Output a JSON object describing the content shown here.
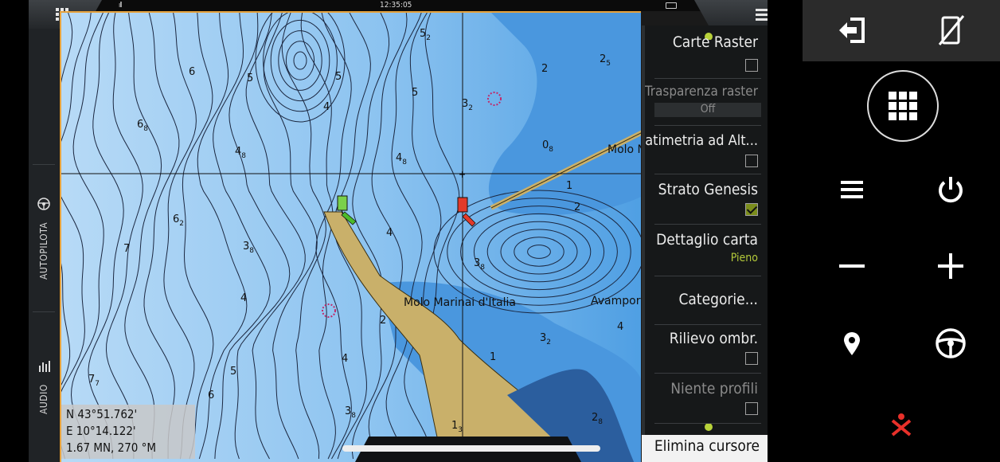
{
  "status": {
    "clock": "12:35:05",
    "signal": "ıll"
  },
  "side_panel": {
    "autopilot_label": "AUTOPILOTA",
    "audio_label": "AUDIO"
  },
  "chart": {
    "soundings": [
      {
        "t": "5",
        "s": "2"
      },
      {
        "t": "2",
        "s": ""
      },
      {
        "t": "2",
        "s": "5"
      },
      {
        "t": "6",
        "s": ""
      },
      {
        "t": "5",
        "s": ""
      },
      {
        "t": "5",
        "s": ""
      },
      {
        "t": "5",
        "s": ""
      },
      {
        "t": "3",
        "s": "2"
      },
      {
        "t": "4",
        "s": ""
      },
      {
        "t": "6",
        "s": "8"
      },
      {
        "t": "4",
        "s": "8"
      },
      {
        "t": "4",
        "s": "8"
      },
      {
        "t": "0",
        "s": "8"
      },
      {
        "t": "1",
        "s": ""
      },
      {
        "t": "2",
        "s": ""
      },
      {
        "t": "6",
        "s": "2"
      },
      {
        "t": "4",
        "s": ""
      },
      {
        "t": "7",
        "s": ""
      },
      {
        "t": "3",
        "s": "8"
      },
      {
        "t": "3",
        "s": "8"
      },
      {
        "t": "4",
        "s": ""
      },
      {
        "t": "2",
        "s": ""
      },
      {
        "t": "3",
        "s": "2"
      },
      {
        "t": "1",
        "s": ""
      },
      {
        "t": "4",
        "s": ""
      },
      {
        "t": "5",
        "s": ""
      },
      {
        "t": "7",
        "s": "7"
      },
      {
        "t": "6",
        "s": ""
      },
      {
        "t": "3",
        "s": "8"
      },
      {
        "t": "1",
        "s": "3"
      },
      {
        "t": "2",
        "s": "8"
      },
      {
        "t": "4",
        "s": ""
      }
    ],
    "labels": {
      "molo_marinai": "Molo Marinai d'Italia",
      "molo_top": "Molo N",
      "avamport": "Avamport"
    },
    "colors": {
      "shallow": "#5aa8e8",
      "deep": "#a9d4f5",
      "land": "#c9b06a",
      "contour": "#1b2740"
    }
  },
  "cursor_info": {
    "lat": "N  43°51.762'",
    "lon": "E  10°14.122'",
    "range_bearing": "1.67 MN, 270 °M"
  },
  "layers_menu": {
    "carte_raster": {
      "label": "Carte Raster",
      "checked": false
    },
    "trasparenza": {
      "label": "Trasparenza raster",
      "value": "Off"
    },
    "batimetria": {
      "label": "Batimetria ad Alt...",
      "checked": false
    },
    "strato_genesis": {
      "label": "Strato Genesis",
      "checked": true
    },
    "dettaglio": {
      "label": "Dettaglio carta",
      "value": "Pieno"
    },
    "categorie": {
      "label": "Categorie..."
    },
    "rilievo": {
      "label": "Rilievo ombr.",
      "checked": false
    },
    "profili": {
      "label": "Niente profili",
      "checked": false
    }
  },
  "elimina_cursore": "Elimina cursore",
  "icons": {
    "apps": "grid-icon",
    "menu": "hamburger-icon",
    "exit": "exit-icon",
    "no_phone": "phone-off-icon",
    "power": "power-icon",
    "zoom_out": "minus-icon",
    "zoom_in": "plus-icon",
    "waypoint": "location-pin-icon",
    "steering": "steering-wheel-icon",
    "mob": "man-overboard-icon"
  }
}
